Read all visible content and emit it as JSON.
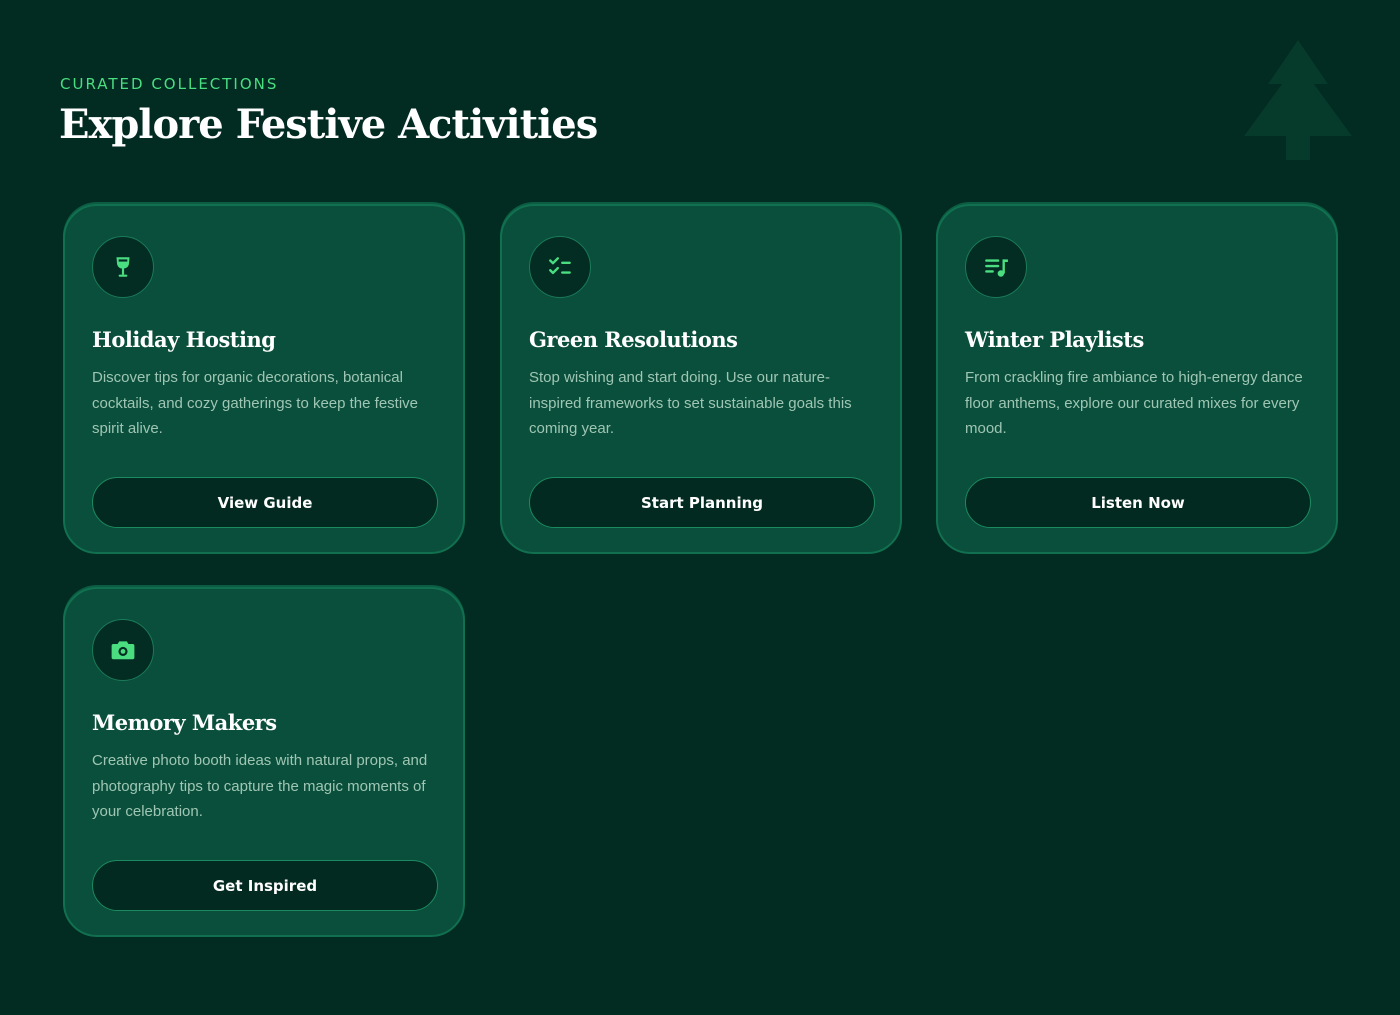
{
  "header": {
    "eyebrow": "CURATED COLLECTIONS",
    "title": "Explore Festive Activities"
  },
  "colors": {
    "background": "#022b22",
    "card": "#0a4f3b",
    "accent": "#4ade80",
    "button": "#032a20"
  },
  "cards": [
    {
      "icon": "wine-glass-icon",
      "title": "Holiday Hosting",
      "description": "Discover tips for organic decorations, botanical cocktails, and cozy gatherings to keep the festive spirit alive.",
      "button_label": "View Guide"
    },
    {
      "icon": "checklist-icon",
      "title": "Green Resolutions",
      "description": "Stop wishing and start doing. Use our nature-inspired frameworks to set sustainable goals this coming year.",
      "button_label": "Start Planning"
    },
    {
      "icon": "playlist-icon",
      "title": "Winter Playlists",
      "description": "From crackling fire ambiance to high-energy dance floor anthems, explore our curated mixes for every mood.",
      "button_label": "Listen Now"
    },
    {
      "icon": "camera-icon",
      "title": "Memory Makers",
      "description": "Creative photo booth ideas with natural props, and photography tips to capture the magic moments of your celebration.",
      "button_label": "Get Inspired"
    }
  ]
}
